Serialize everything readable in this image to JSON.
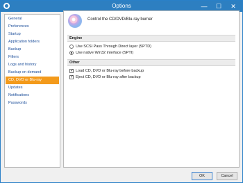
{
  "window": {
    "title": "Options",
    "minimize_glyph": "—",
    "maximize_glyph": "☐",
    "close_glyph": "✕"
  },
  "sidebar": {
    "items": [
      {
        "label": "General"
      },
      {
        "label": "Preferences"
      },
      {
        "label": "Startup"
      },
      {
        "label": "Application folders"
      },
      {
        "label": "Backup"
      },
      {
        "label": "Filters"
      },
      {
        "label": "Logs and history"
      },
      {
        "label": "Backup on demand"
      },
      {
        "label": "CD, DVD or Blu-ray",
        "active": true
      },
      {
        "label": "Updates"
      },
      {
        "label": "Notifications"
      },
      {
        "label": "Passwords"
      }
    ]
  },
  "content": {
    "title": "Control the CD/DVD/Blu-ray burner",
    "engine": {
      "heading": "Engine",
      "options": [
        {
          "label": "Use SCSI Pass Through Direct layer (SPTD)",
          "selected": false
        },
        {
          "label": "Use native Win32 interface (SPTI)",
          "selected": true
        }
      ]
    },
    "other": {
      "heading": "Other",
      "options": [
        {
          "label": "Load CD, DVD or Blu-ray before backup",
          "checked": true
        },
        {
          "label": "Eject CD, DVD or Blu-ray after backup",
          "checked": true
        }
      ]
    }
  },
  "buttons": {
    "ok": "OK",
    "cancel": "Cancel"
  },
  "colors": {
    "titlebar": "#2d7fc1",
    "active_item": "#f39a1b",
    "link_text": "#1c4e9a"
  }
}
